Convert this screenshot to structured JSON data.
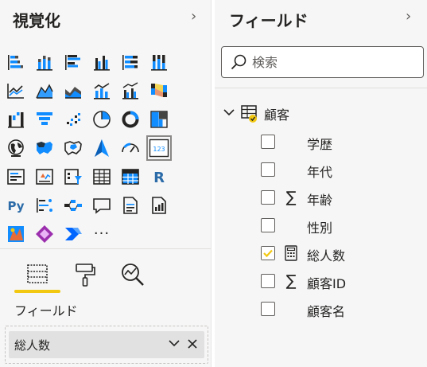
{
  "visualizations": {
    "title": "視覚化",
    "icons": [
      "stacked-bar-icon",
      "stacked-column-icon",
      "clustered-bar-icon",
      "clustered-column-icon",
      "stacked-bar-100-icon",
      "stacked-column-100-icon",
      "",
      "line-chart-icon",
      "area-chart-icon",
      "stacked-area-icon",
      "line-column-icon",
      "line-clustered-column-icon",
      "ribbon-chart-icon",
      "",
      "waterfall-icon",
      "funnel-icon",
      "scatter-icon",
      "pie-icon",
      "donut-icon",
      "treemap-icon",
      "",
      "map-icon",
      "filled-map-icon",
      "shape-map-icon",
      "azure-map-icon",
      "gauge-icon",
      "card-icon",
      "",
      "multi-row-card-icon",
      "kpi-icon",
      "slicer-icon",
      "table-icon",
      "matrix-icon",
      "r-visual-icon",
      "",
      "python-visual-icon",
      "key-influencers-icon",
      "decomposition-tree-icon",
      "qa-icon",
      "smart-narrative-icon",
      "paginated-report-icon",
      "",
      "arcgis-map-icon",
      "power-apps-icon",
      "power-automate-icon",
      "more-visuals-icon"
    ],
    "r_label": "R",
    "py_label": "Py",
    "card_label": "123",
    "more_label": "···",
    "subtabs": [
      "fields-tab",
      "format-tab",
      "analytics-tab"
    ],
    "section_label": "フィールド",
    "well_value": "総人数",
    "accent": "#f2c811"
  },
  "fields": {
    "title": "フィールド",
    "search_placeholder": "検索",
    "table": {
      "name": "顧客",
      "expanded": true,
      "partially_checked": true,
      "columns": [
        {
          "name": "学歴",
          "icon": "",
          "checked": false
        },
        {
          "name": "年代",
          "icon": "",
          "checked": false
        },
        {
          "name": "年齢",
          "icon": "sigma-icon",
          "checked": false
        },
        {
          "name": "性別",
          "icon": "",
          "checked": false
        },
        {
          "name": "総人数",
          "icon": "calculator-icon",
          "checked": true
        },
        {
          "name": "顧客ID",
          "icon": "sigma-icon",
          "checked": false
        },
        {
          "name": "顧客名",
          "icon": "",
          "checked": false
        }
      ]
    }
  }
}
